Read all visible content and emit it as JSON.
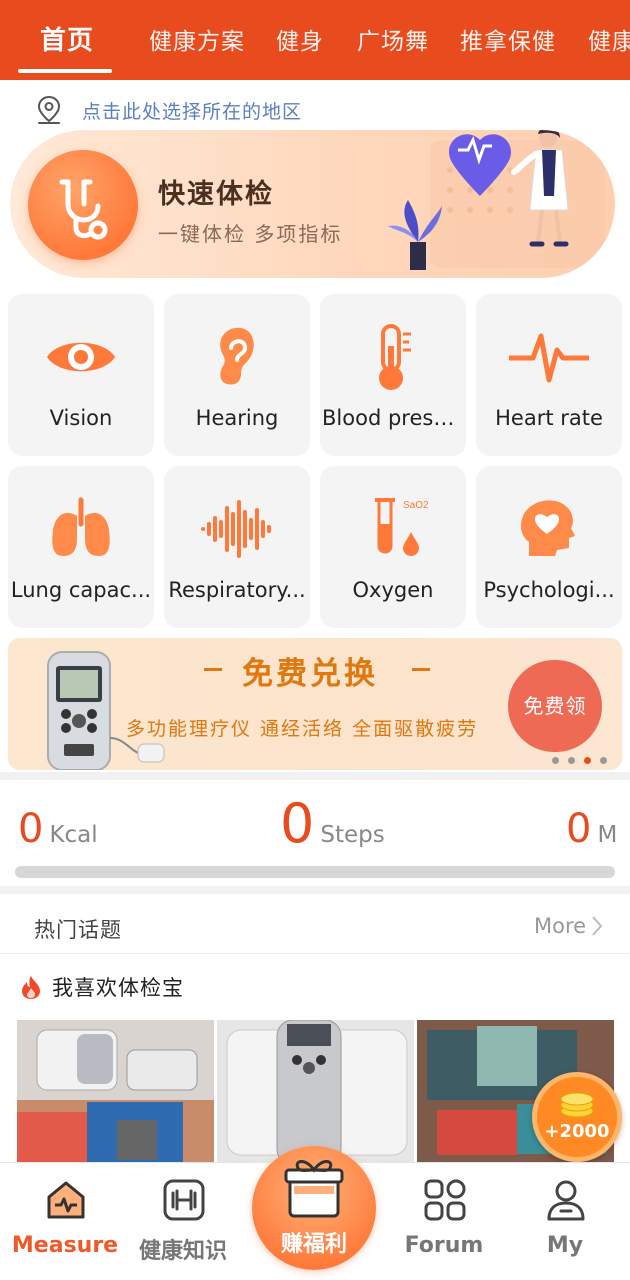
{
  "topTabs": {
    "active": "首页",
    "tabs": [
      "健康方案",
      "健身",
      "广场舞",
      "推拿保健",
      "健康"
    ]
  },
  "location": {
    "text": "点击此处选择所在的地区"
  },
  "quickCheck": {
    "title": "快速体检",
    "subtitle": "一键体检 多项指标"
  },
  "grid": {
    "items": [
      {
        "label": "Vision",
        "icon": "eye-icon"
      },
      {
        "label": "Hearing",
        "icon": "ear-icon"
      },
      {
        "label": "Blood press...",
        "icon": "thermometer-icon"
      },
      {
        "label": "Heart rate",
        "icon": "heartbeat-icon"
      },
      {
        "label": "Lung capac...",
        "icon": "lungs-icon"
      },
      {
        "label": "Respiratory...",
        "icon": "waveform-icon"
      },
      {
        "label": "Oxygen",
        "icon": "test-tube-icon"
      },
      {
        "label": "Psychologi...",
        "icon": "head-heart-icon"
      }
    ],
    "oxygenTag": "SaO2"
  },
  "promo": {
    "title": "免费兑换",
    "desc": "多功能理疗仪 通经活络 全面驱散疲劳",
    "button": "免费领",
    "activeDot": 2
  },
  "stats": {
    "kcal": {
      "value": "0",
      "unit": "Kcal"
    },
    "steps": {
      "value": "0",
      "unit": "Steps"
    },
    "meters": {
      "value": "0",
      "unit": "M"
    },
    "progress": 0
  },
  "topics": {
    "header": "热门话题",
    "more": "More",
    "title": "我喜欢体检宝"
  },
  "reward": {
    "amount": "+2000"
  },
  "bottomNav": {
    "measure": "Measure",
    "knowledge": "健康知识",
    "center": "赚福利",
    "forum": "Forum",
    "my": "My"
  },
  "colors": {
    "accent": "#e84c1e",
    "orange": "#ff7a3a"
  }
}
